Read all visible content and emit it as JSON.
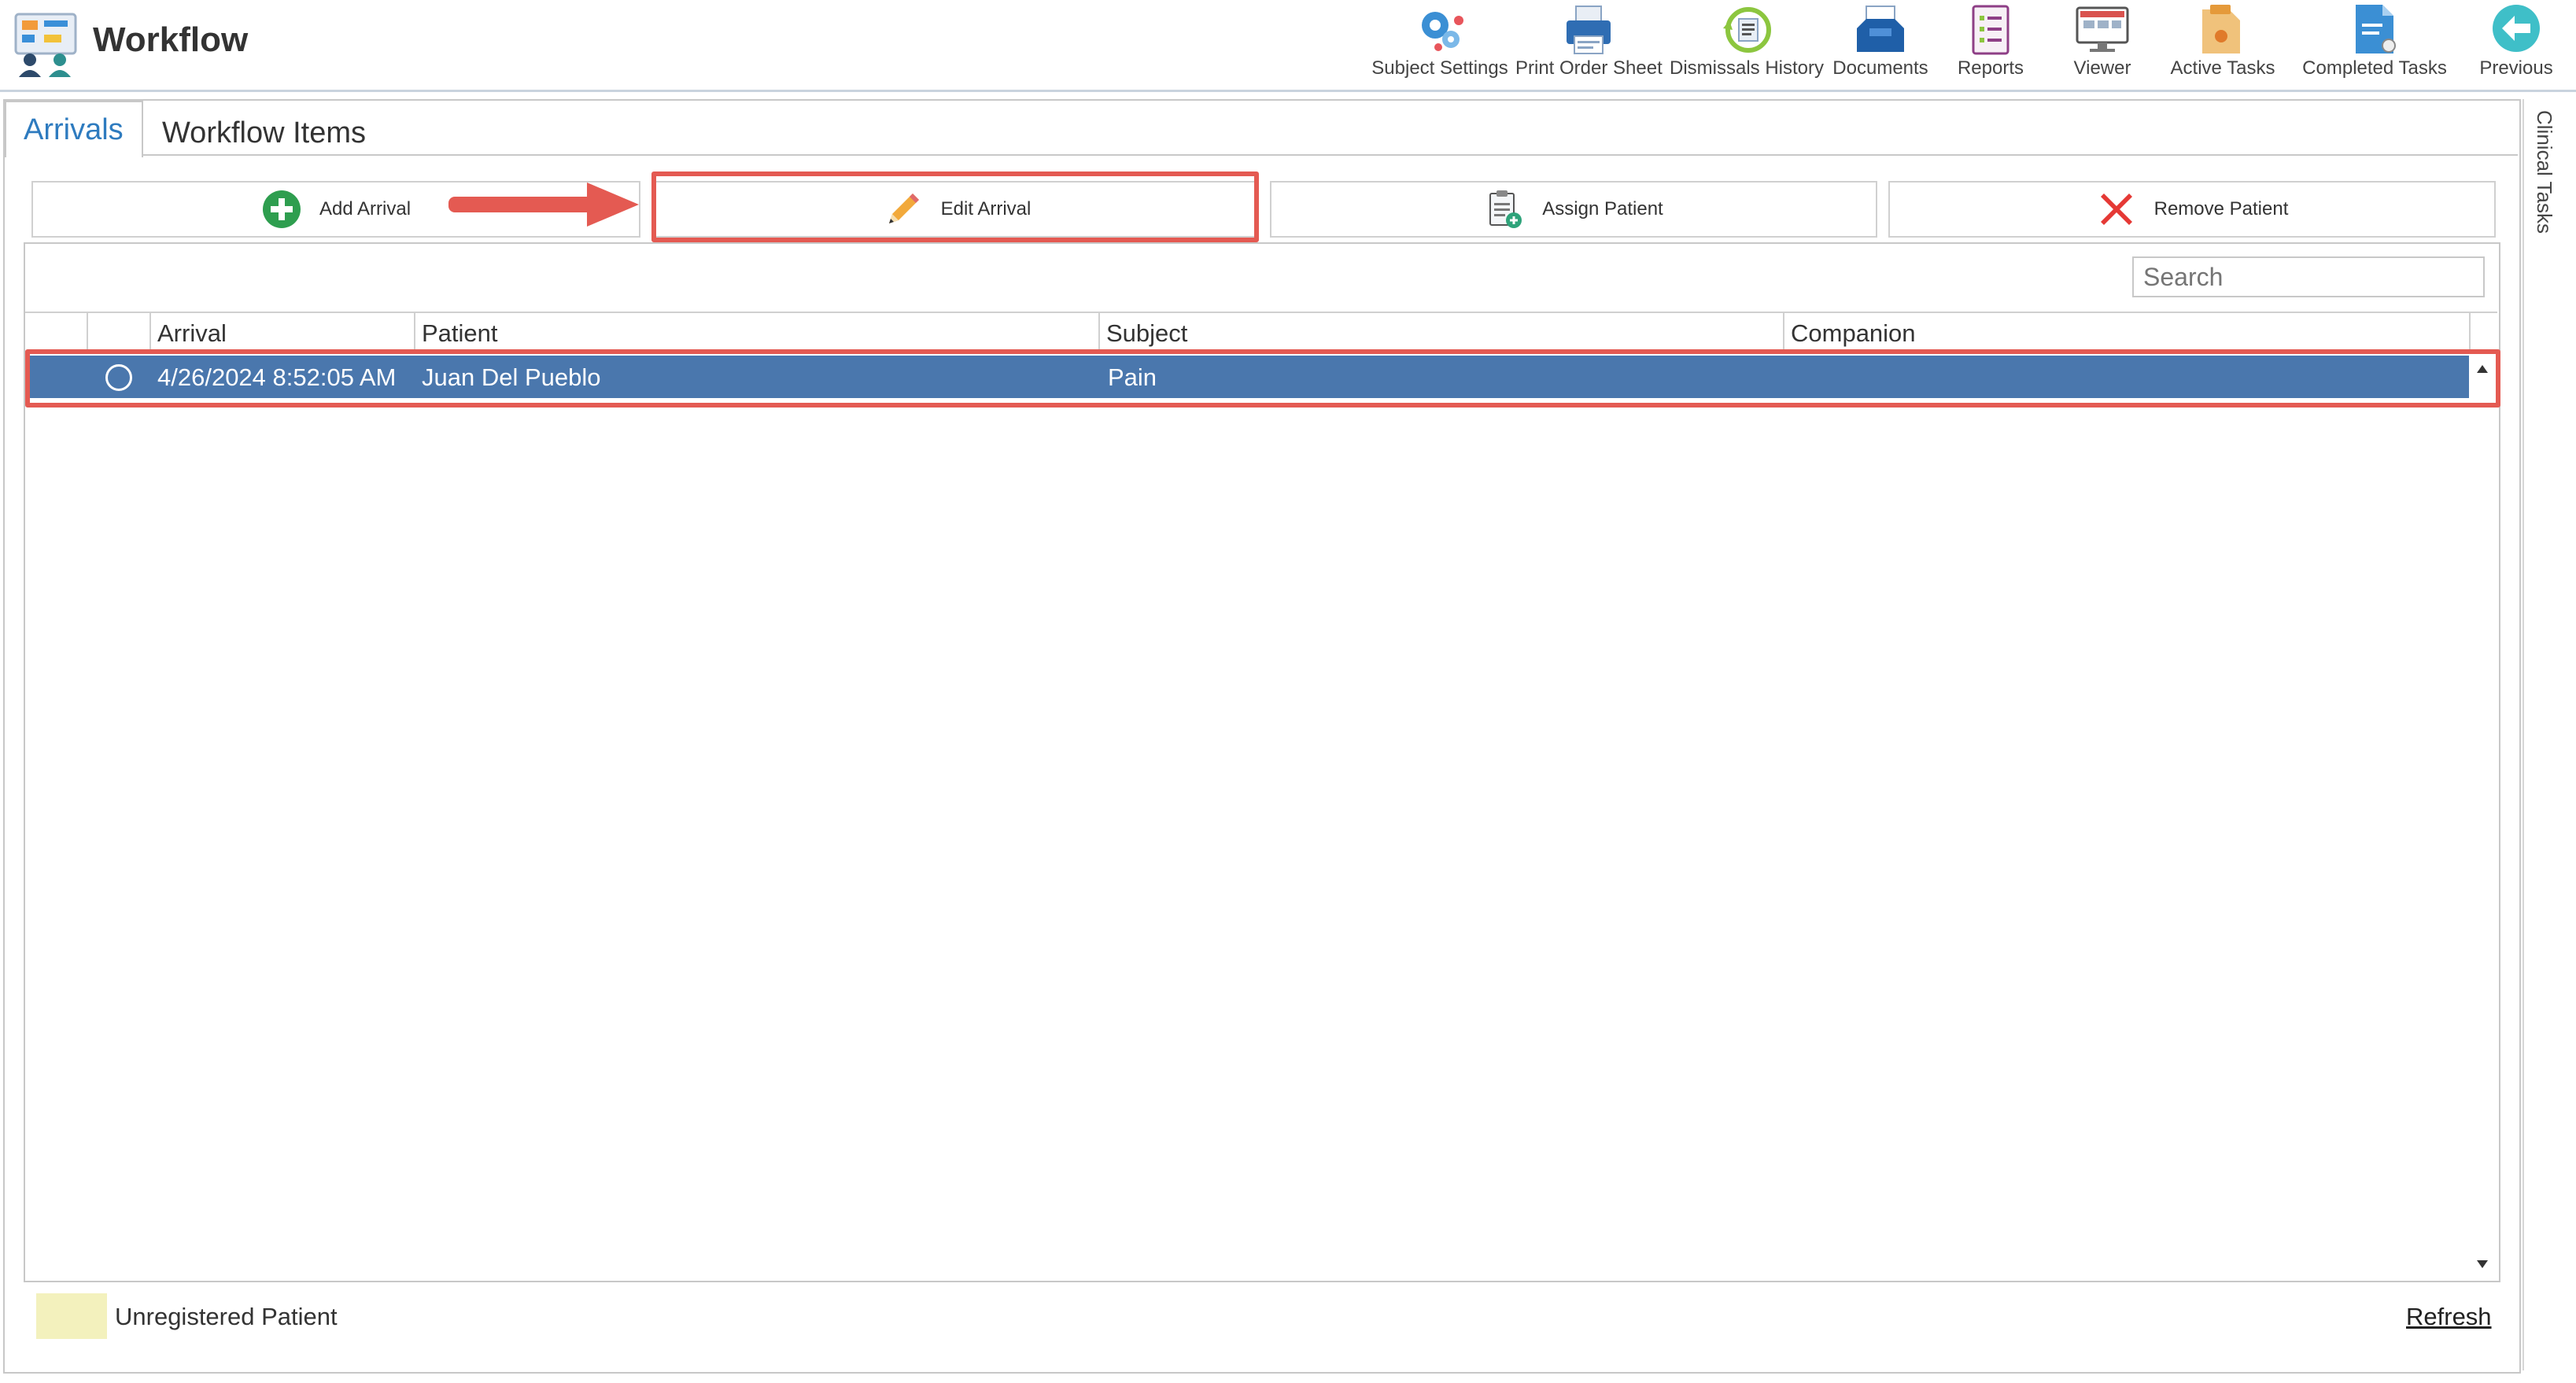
{
  "app": {
    "title": "Workflow"
  },
  "toolbar": {
    "items": [
      {
        "label": "Subject Settings",
        "icon": "gears-icon"
      },
      {
        "label": "Print Order Sheet",
        "icon": "printer-icon"
      },
      {
        "label": "Dismissals History",
        "icon": "history-icon"
      },
      {
        "label": "Documents",
        "icon": "inbox-tray-icon"
      },
      {
        "label": "Reports",
        "icon": "report-icon"
      },
      {
        "label": "Viewer",
        "icon": "monitor-icon"
      },
      {
        "label": "Active Tasks",
        "icon": "task-folder-icon"
      },
      {
        "label": "Completed Tasks",
        "icon": "completed-document-icon"
      },
      {
        "label": "Previous",
        "icon": "back-arrow-icon"
      }
    ]
  },
  "tabs": [
    {
      "label": "Arrivals",
      "active": true
    },
    {
      "label": "Workflow Items",
      "active": false
    }
  ],
  "side_panel": {
    "label": "Clinical Tasks"
  },
  "actions": {
    "add_arrival": "Add Arrival",
    "edit_arrival": "Edit Arrival",
    "assign_patient": "Assign Patient",
    "remove_patient": "Remove Patient"
  },
  "search": {
    "placeholder": "Search",
    "value": ""
  },
  "grid": {
    "columns": [
      "",
      "",
      "Arrival",
      "Patient",
      "Subject",
      "Companion"
    ],
    "rows": [
      {
        "arrival": "4/26/2024 8:52:05 AM",
        "patient": "Juan Del Pueblo",
        "subject": "Pain",
        "companion": "",
        "selected": true
      }
    ]
  },
  "legend": {
    "label": "Unregistered Patient",
    "color": "#f3f1bd"
  },
  "footer": {
    "refresh": "Refresh"
  },
  "colors": {
    "accent": "#2e7bbf",
    "selected_row": "#4a77ad",
    "highlight": "#e45a52"
  }
}
